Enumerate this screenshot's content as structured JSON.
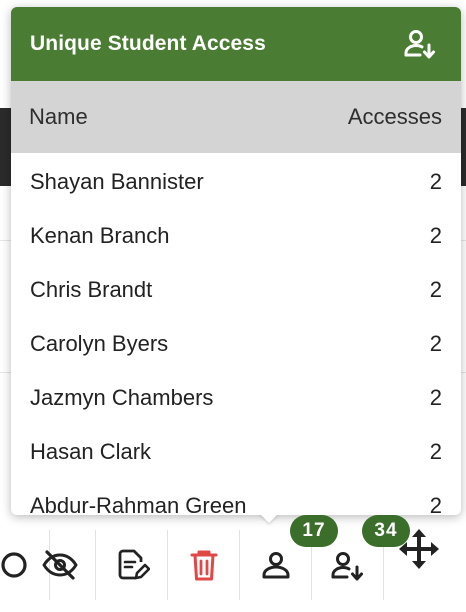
{
  "popover": {
    "title": "Unique Student Access",
    "header_icon": "person-download-icon",
    "columns": {
      "name": "Name",
      "accesses": "Accesses"
    },
    "rows": [
      {
        "name": "Shayan Bannister",
        "accesses": "2"
      },
      {
        "name": "Kenan Branch",
        "accesses": "2"
      },
      {
        "name": "Chris Brandt",
        "accesses": "2"
      },
      {
        "name": "Carolyn Byers",
        "accesses": "2"
      },
      {
        "name": "Jazmyn Chambers",
        "accesses": "2"
      },
      {
        "name": "Hasan Clark",
        "accesses": "2"
      },
      {
        "name": "Abdur-Rahman Green",
        "accesses": "2"
      }
    ]
  },
  "toolbar": {
    "buttons": [
      {
        "icon": "circle-partial-icon"
      },
      {
        "icon": "eye-slash-icon"
      },
      {
        "icon": "edit-document-icon"
      },
      {
        "icon": "trash-icon"
      },
      {
        "icon": "person-icon",
        "badge": "17"
      },
      {
        "icon": "person-download-icon",
        "badge": "34"
      },
      {
        "icon": "move-icon"
      }
    ]
  },
  "colors": {
    "header_green": "#4a7d33",
    "badge_green": "#3c6e2b",
    "column_header_gray": "#d4d4d4",
    "delete_red": "#e04848",
    "icon_dark": "#222222"
  }
}
